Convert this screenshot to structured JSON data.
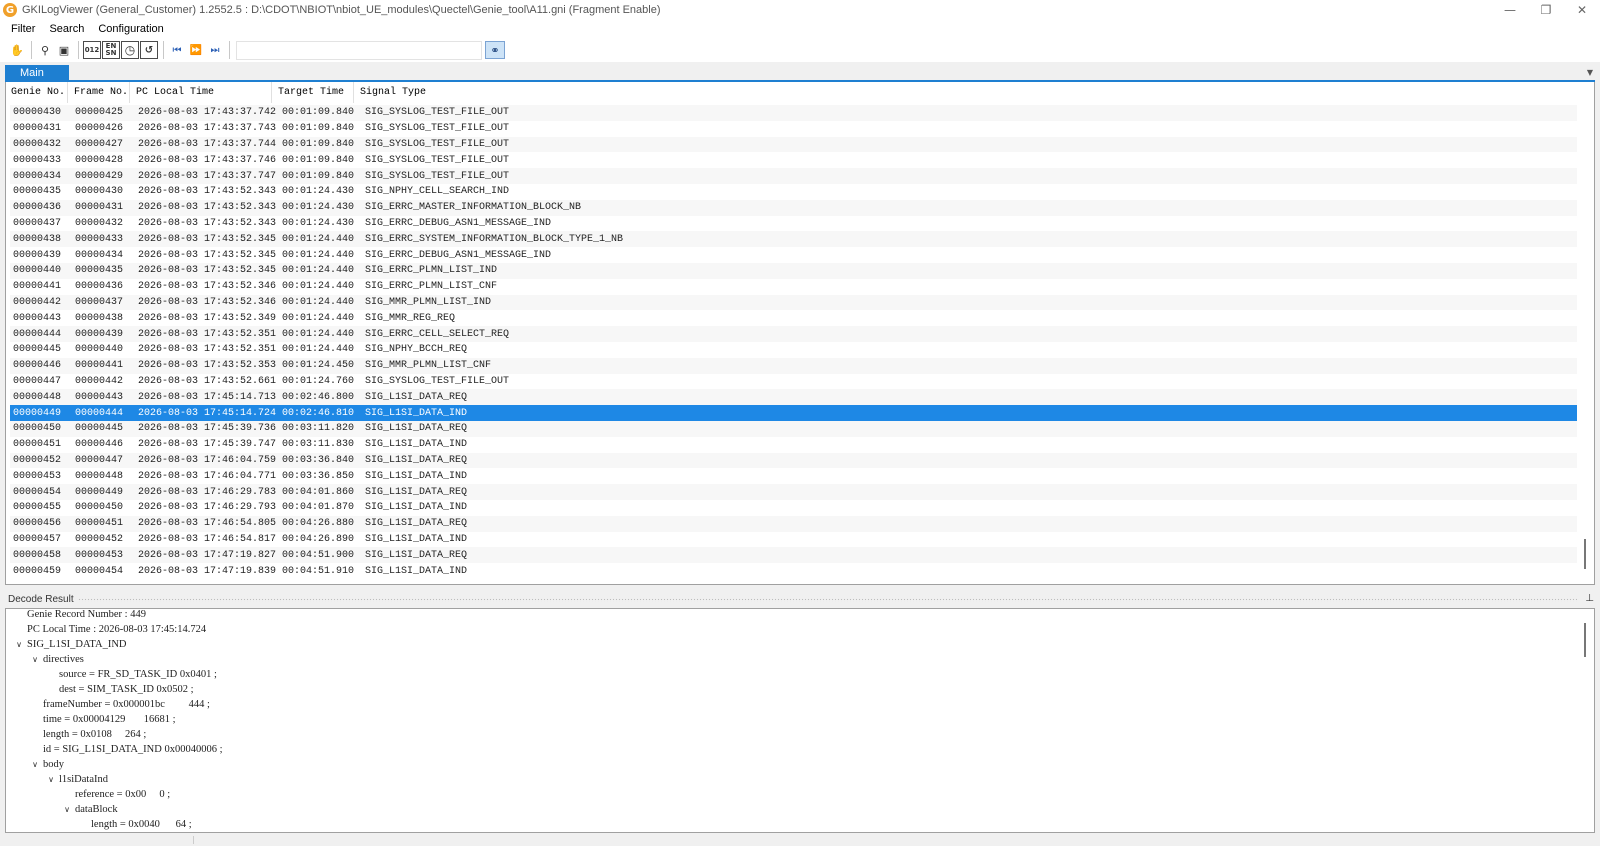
{
  "window": {
    "icon_letter": "G",
    "title": "GKILogViewer  (General_Customer) 1.2552.5 : D:\\CDOT\\NBIOT\\nbiot_UE_modules\\Quectel\\Genie_tool\\A11.gni  (Fragment Enable)",
    "minimize": "—",
    "restore": "❐",
    "close": "✕"
  },
  "menu": {
    "items": [
      "Filter",
      "Search",
      "Configuration"
    ]
  },
  "toolbar": {
    "icons": [
      "hand-icon",
      "filter-icon",
      "save-icon",
      "hex-view-icon",
      "en-sn-icon",
      "clock-icon",
      "refresh-icon",
      "first-icon",
      "next-icon",
      "last-icon",
      "binoculars-icon"
    ],
    "hex_label": "012",
    "en_label": "EN",
    "sn_label": "SN",
    "search_value": ""
  },
  "tabs": {
    "main": "Main"
  },
  "grid": {
    "columns": [
      "Genie No.",
      "Frame No.",
      "PC Local Time",
      "Target Time",
      "Signal Type"
    ],
    "selected_index": 19,
    "rows": [
      [
        "00000430",
        "00000425",
        "2026-08-03 17:43:37.742",
        "00:01:09.840",
        "SIG_SYSLOG_TEST_FILE_OUT"
      ],
      [
        "00000431",
        "00000426",
        "2026-08-03 17:43:37.743",
        "00:01:09.840",
        "SIG_SYSLOG_TEST_FILE_OUT"
      ],
      [
        "00000432",
        "00000427",
        "2026-08-03 17:43:37.744",
        "00:01:09.840",
        "SIG_SYSLOG_TEST_FILE_OUT"
      ],
      [
        "00000433",
        "00000428",
        "2026-08-03 17:43:37.746",
        "00:01:09.840",
        "SIG_SYSLOG_TEST_FILE_OUT"
      ],
      [
        "00000434",
        "00000429",
        "2026-08-03 17:43:37.747",
        "00:01:09.840",
        "SIG_SYSLOG_TEST_FILE_OUT"
      ],
      [
        "00000435",
        "00000430",
        "2026-08-03 17:43:52.343",
        "00:01:24.430",
        "SIG_NPHY_CELL_SEARCH_IND"
      ],
      [
        "00000436",
        "00000431",
        "2026-08-03 17:43:52.343",
        "00:01:24.430",
        "SIG_ERRC_MASTER_INFORMATION_BLOCK_NB"
      ],
      [
        "00000437",
        "00000432",
        "2026-08-03 17:43:52.343",
        "00:01:24.430",
        "SIG_ERRC_DEBUG_ASN1_MESSAGE_IND"
      ],
      [
        "00000438",
        "00000433",
        "2026-08-03 17:43:52.345",
        "00:01:24.440",
        "SIG_ERRC_SYSTEM_INFORMATION_BLOCK_TYPE_1_NB"
      ],
      [
        "00000439",
        "00000434",
        "2026-08-03 17:43:52.345",
        "00:01:24.440",
        "SIG_ERRC_DEBUG_ASN1_MESSAGE_IND"
      ],
      [
        "00000440",
        "00000435",
        "2026-08-03 17:43:52.345",
        "00:01:24.440",
        "SIG_ERRC_PLMN_LIST_IND"
      ],
      [
        "00000441",
        "00000436",
        "2026-08-03 17:43:52.346",
        "00:01:24.440",
        "SIG_ERRC_PLMN_LIST_CNF"
      ],
      [
        "00000442",
        "00000437",
        "2026-08-03 17:43:52.346",
        "00:01:24.440",
        "SIG_MMR_PLMN_LIST_IND"
      ],
      [
        "00000443",
        "00000438",
        "2026-08-03 17:43:52.349",
        "00:01:24.440",
        "SIG_MMR_REG_REQ"
      ],
      [
        "00000444",
        "00000439",
        "2026-08-03 17:43:52.351",
        "00:01:24.440",
        "SIG_ERRC_CELL_SELECT_REQ"
      ],
      [
        "00000445",
        "00000440",
        "2026-08-03 17:43:52.351",
        "00:01:24.440",
        "SIG_NPHY_BCCH_REQ"
      ],
      [
        "00000446",
        "00000441",
        "2026-08-03 17:43:52.353",
        "00:01:24.450",
        "SIG_MMR_PLMN_LIST_CNF"
      ],
      [
        "00000447",
        "00000442",
        "2026-08-03 17:43:52.661",
        "00:01:24.760",
        "SIG_SYSLOG_TEST_FILE_OUT"
      ],
      [
        "00000448",
        "00000443",
        "2026-08-03 17:45:14.713",
        "00:02:46.800",
        "SIG_L1SI_DATA_REQ"
      ],
      [
        "00000449",
        "00000444",
        "2026-08-03 17:45:14.724",
        "00:02:46.810",
        "SIG_L1SI_DATA_IND"
      ],
      [
        "00000450",
        "00000445",
        "2026-08-03 17:45:39.736",
        "00:03:11.820",
        "SIG_L1SI_DATA_REQ"
      ],
      [
        "00000451",
        "00000446",
        "2026-08-03 17:45:39.747",
        "00:03:11.830",
        "SIG_L1SI_DATA_IND"
      ],
      [
        "00000452",
        "00000447",
        "2026-08-03 17:46:04.759",
        "00:03:36.840",
        "SIG_L1SI_DATA_REQ"
      ],
      [
        "00000453",
        "00000448",
        "2026-08-03 17:46:04.771",
        "00:03:36.850",
        "SIG_L1SI_DATA_IND"
      ],
      [
        "00000454",
        "00000449",
        "2026-08-03 17:46:29.783",
        "00:04:01.860",
        "SIG_L1SI_DATA_REQ"
      ],
      [
        "00000455",
        "00000450",
        "2026-08-03 17:46:29.793",
        "00:04:01.870",
        "SIG_L1SI_DATA_IND"
      ],
      [
        "00000456",
        "00000451",
        "2026-08-03 17:46:54.805",
        "00:04:26.880",
        "SIG_L1SI_DATA_REQ"
      ],
      [
        "00000457",
        "00000452",
        "2026-08-03 17:46:54.817",
        "00:04:26.890",
        "SIG_L1SI_DATA_IND"
      ],
      [
        "00000458",
        "00000453",
        "2026-08-03 17:47:19.827",
        "00:04:51.900",
        "SIG_L1SI_DATA_REQ"
      ],
      [
        "00000459",
        "00000454",
        "2026-08-03 17:47:19.839",
        "00:04:51.910",
        "SIG_L1SI_DATA_IND"
      ]
    ]
  },
  "decode": {
    "title": "Decode Result",
    "lines": [
      {
        "depth": 0,
        "chevron": false,
        "text": "Genie Record Number : 449"
      },
      {
        "depth": 0,
        "chevron": false,
        "text": "PC Local Time : 2026-08-03 17:45:14.724"
      },
      {
        "depth": 0,
        "chevron": true,
        "text": "SIG_L1SI_DATA_IND"
      },
      {
        "depth": 1,
        "chevron": true,
        "text": "directives"
      },
      {
        "depth": 2,
        "chevron": false,
        "text": "source = FR_SD_TASK_ID 0x0401 ;"
      },
      {
        "depth": 2,
        "chevron": false,
        "text": "dest = SIM_TASK_ID 0x0502 ;"
      },
      {
        "depth": 1,
        "chevron": false,
        "text": "frameNumber = 0x000001bc         444 ;"
      },
      {
        "depth": 1,
        "chevron": false,
        "text": "time = 0x00004129       16681 ;"
      },
      {
        "depth": 1,
        "chevron": false,
        "text": "length = 0x0108     264 ;"
      },
      {
        "depth": 1,
        "chevron": false,
        "text": "id = SIG_L1SI_DATA_IND 0x00040006 ;"
      },
      {
        "depth": 1,
        "chevron": true,
        "text": "body"
      },
      {
        "depth": 2,
        "chevron": true,
        "text": "l1siDataInd"
      },
      {
        "depth": 3,
        "chevron": false,
        "text": "reference = 0x00     0 ;"
      },
      {
        "depth": 3,
        "chevron": true,
        "text": "dataBlock"
      },
      {
        "depth": 4,
        "chevron": false,
        "text": "length = 0x0040      64 ;"
      }
    ]
  },
  "colors": {
    "selection": "#1e88e5",
    "tab_accent": "#1e7fd1"
  }
}
